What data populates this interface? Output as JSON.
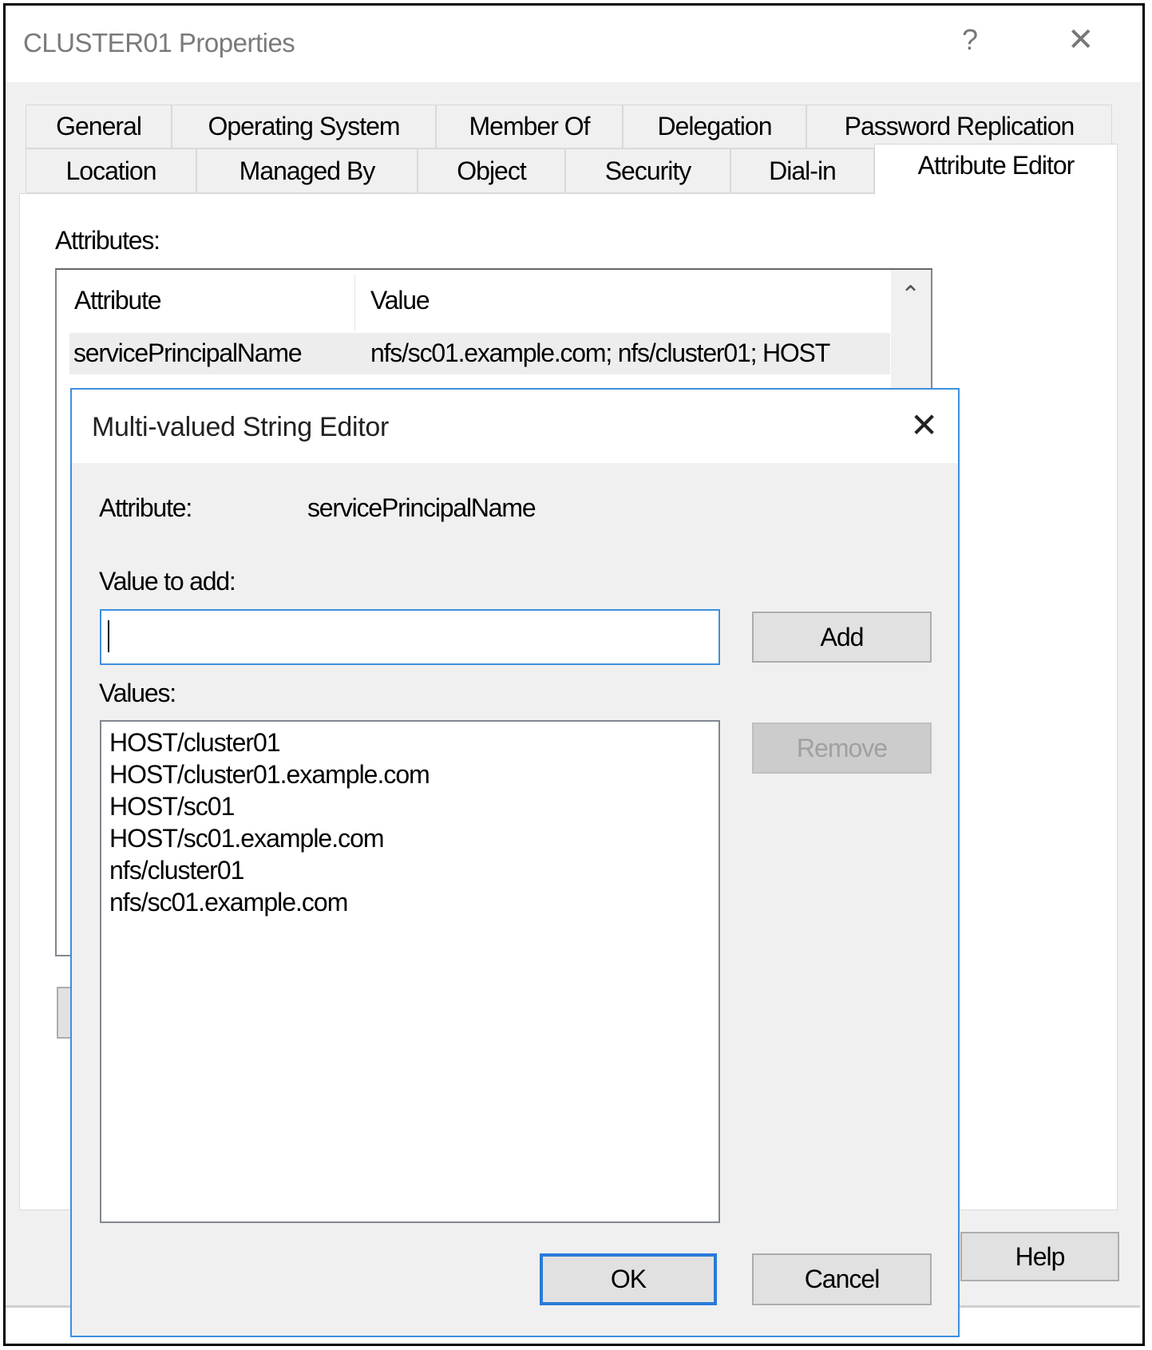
{
  "window": {
    "title": "CLUSTER01 Properties",
    "help_glyph": "?",
    "close_glyph": "✕"
  },
  "tabs": {
    "row1": [
      "General",
      "Operating System",
      "Member Of",
      "Delegation",
      "Password Replication"
    ],
    "row2": [
      "Location",
      "Managed By",
      "Object",
      "Security",
      "Dial-in",
      "Attribute Editor"
    ],
    "selected": "Attribute Editor"
  },
  "attribute_editor": {
    "attributes_label": "Attributes:",
    "columns": [
      "Attribute",
      "Value"
    ],
    "rows": [
      {
        "attribute": "servicePrincipalName",
        "value": "nfs/sc01.example.com; nfs/cluster01; HOST"
      }
    ],
    "scroll_up_glyph": "⌃"
  },
  "footer": {
    "help_label": "Help"
  },
  "dialog": {
    "title": "Multi-valued String Editor",
    "close_glyph": "✕",
    "attribute_label": "Attribute:",
    "attribute_value": "servicePrincipalName",
    "value_to_add_label": "Value to add:",
    "value_to_add": "",
    "add_label": "Add",
    "values_label": "Values:",
    "values": [
      "HOST/cluster01",
      "HOST/cluster01.example.com",
      "HOST/sc01",
      "HOST/sc01.example.com",
      "nfs/cluster01",
      "nfs/sc01.example.com"
    ],
    "remove_label": "Remove",
    "ok_label": "OK",
    "cancel_label": "Cancel"
  },
  "colors": {
    "accent": "#3d8fe0",
    "selected_row": "#ededed",
    "disabled_text": "#a0a0a0"
  }
}
